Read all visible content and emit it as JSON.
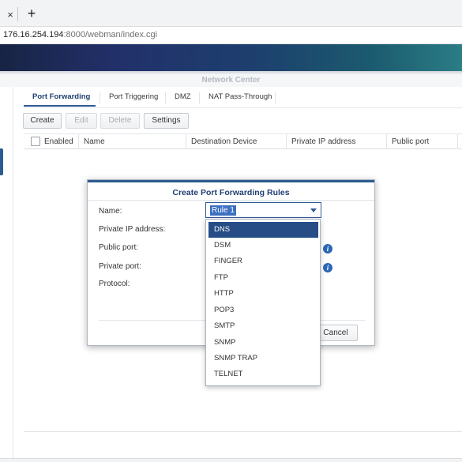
{
  "browser": {
    "tab_close": "×",
    "new_tab": "+",
    "url_host": "176.16.254.194",
    "url_path": ":8000/webman/index.cgi"
  },
  "window": {
    "title": "Network Center"
  },
  "tabs": [
    {
      "label": "Port Forwarding",
      "active": true
    },
    {
      "label": "Port Triggering",
      "active": false
    },
    {
      "label": "DMZ",
      "active": false
    },
    {
      "label": "NAT Pass-Through",
      "active": false
    }
  ],
  "toolbar": {
    "create": "Create",
    "edit": "Edit",
    "delete": "Delete",
    "settings": "Settings"
  },
  "grid": {
    "columns": [
      "Enabled",
      "Name",
      "Destination Device",
      "Private IP address",
      "Public port"
    ]
  },
  "dialog": {
    "title": "Create Port Forwarding Rules",
    "fields": {
      "name": "Name:",
      "private_ip": "Private IP address:",
      "public_port": "Public port:",
      "private_port": "Private port:",
      "protocol": "Protocol:"
    },
    "name_value": "Rule 1",
    "info_glyph": "i",
    "cancel": "Cancel"
  },
  "dropdown": {
    "selected": "DNS",
    "options": [
      "DNS",
      "DSM",
      "FINGER",
      "FTP",
      "HTTP",
      "POP3",
      "SMTP",
      "SNMP",
      "SNMP TRAP",
      "TELNET"
    ]
  },
  "colors": {
    "accent": "#2c5b93",
    "selected_option": "#264d85",
    "info_icon": "#2c66b5"
  }
}
